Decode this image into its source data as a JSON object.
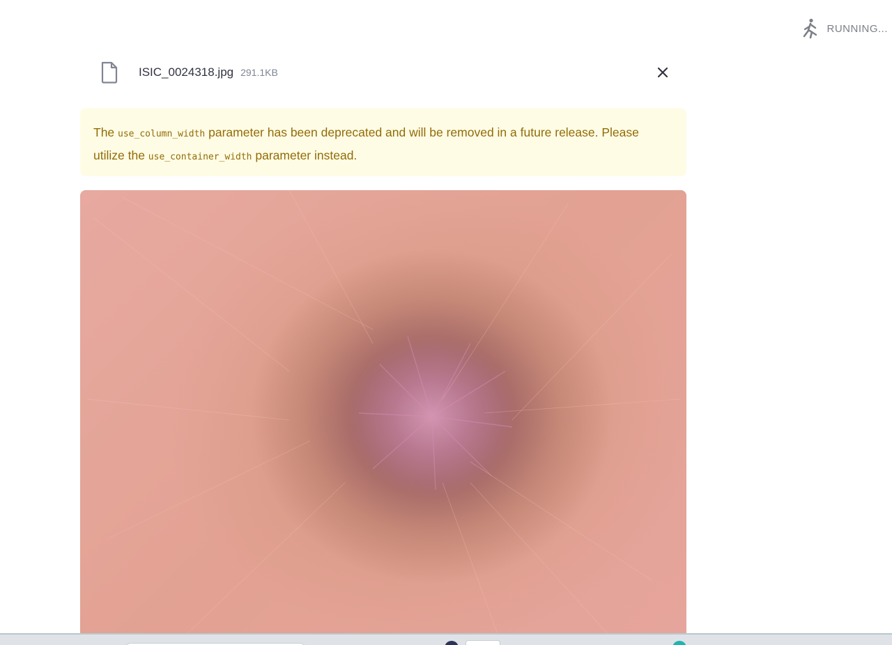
{
  "status": {
    "text": "RUNNING...",
    "icon": "running-person-icon"
  },
  "file": {
    "name": "ISIC_0024318.jpg",
    "size": "291.1KB",
    "icon": "file-icon",
    "close_icon": "close-icon"
  },
  "alert": {
    "text_1": "The ",
    "code_1": "use_column_width",
    "text_2": " parameter has been deprecated and will be removed in a future release. Please utilize the ",
    "code_2": "use_container_width",
    "text_3": " parameter instead."
  },
  "image": {
    "description_icon": "dermoscopy-image"
  },
  "colors": {
    "alert_background": "#fffce6",
    "alert_text": "#926c05",
    "status_text": "#7d7f87"
  }
}
